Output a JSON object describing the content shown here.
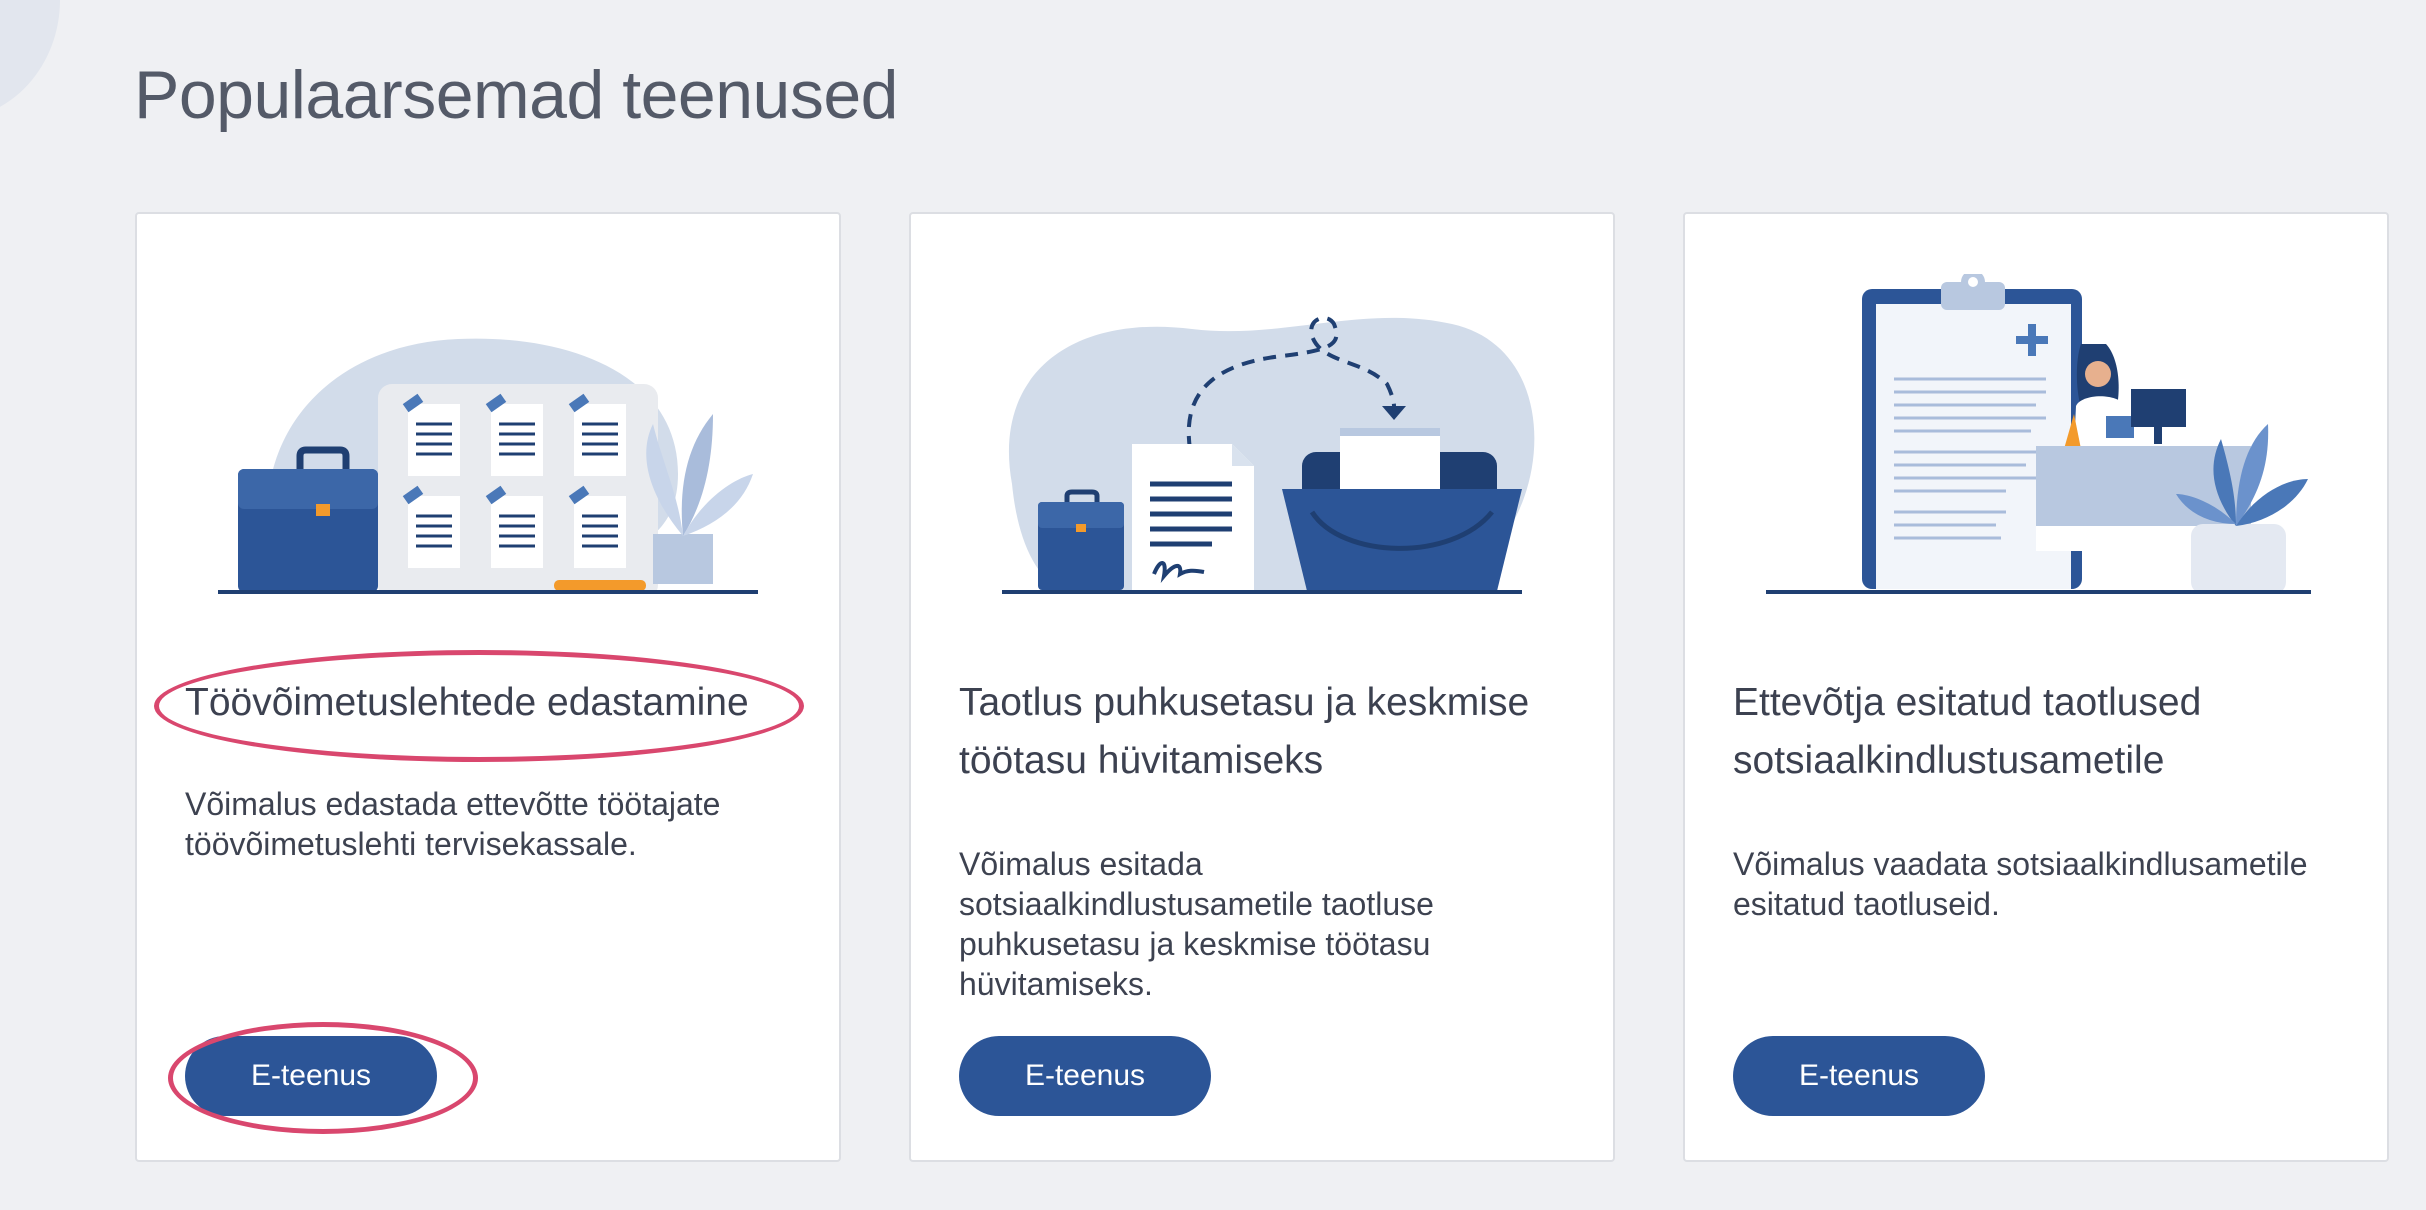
{
  "section": {
    "title": "Populaarsemad teenused"
  },
  "cards": [
    {
      "title": "Töövõimetuslehtede edastamine",
      "description": "Võimalus edastada ettevõtte töötajate töövõimetuslehti tervisekassale.",
      "button_label": "E-teenus",
      "illustration": "briefcase-and-documents-illustration"
    },
    {
      "title": "Taotlus puhkusetasu ja keskmise töötasu hüvitamiseks",
      "description": "Võimalus esitada sotsiaalkindlustusametile taotluse puhkusetasu ja keskmise töötasu hüvitamiseks.",
      "button_label": "E-teenus",
      "illustration": "document-to-folder-illustration"
    },
    {
      "title": "Ettevõtja esitatud taotlused sotsiaalkindlustusametile",
      "description": "Võimalus vaadata sotsiaalkindlusametile esitatud taotluseid.",
      "button_label": "E-teenus",
      "illustration": "clipboard-and-reception-illustration"
    }
  ],
  "colors": {
    "background": "#eff0f3",
    "primary_button": "#2c5597",
    "highlight_annotation": "#d9476e",
    "illustration_dark": "#1f3f72",
    "illustration_light": "#d2dcea"
  }
}
